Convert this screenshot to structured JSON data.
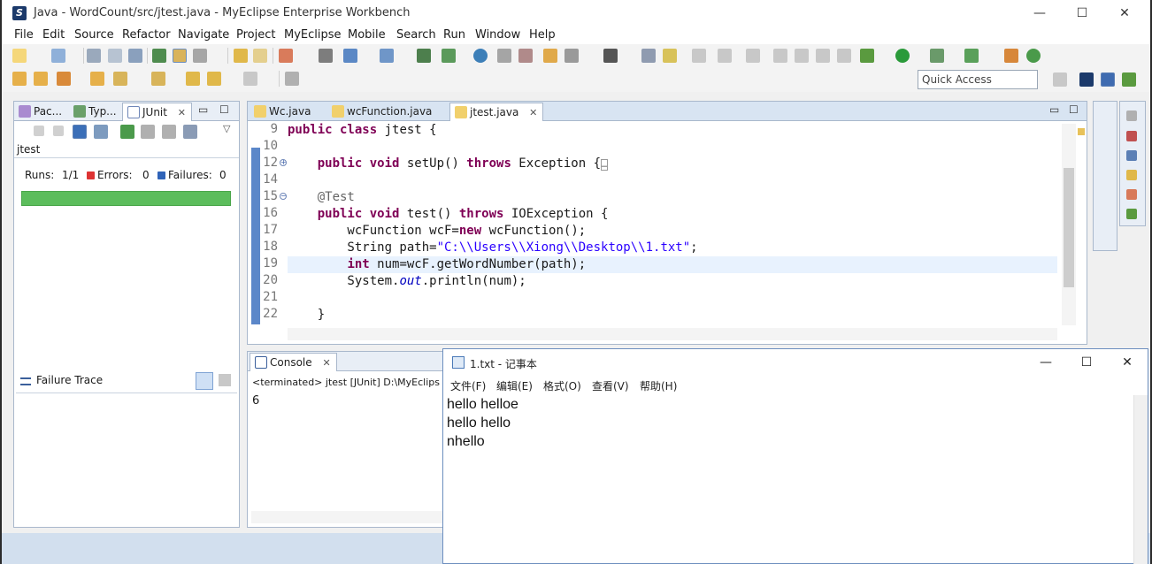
{
  "window": {
    "title": "Java - WordCount/src/jtest.java - MyEclipse Enterprise Workbench",
    "minimize": "—",
    "maximize": "☐",
    "close": "✕"
  },
  "menu": [
    "File",
    "Edit",
    "Source",
    "Refactor",
    "Navigate",
    "Project",
    "MyEclipse",
    "Mobile",
    "Search",
    "Run",
    "Window",
    "Help"
  ],
  "quick_access": {
    "label": "Quick Access"
  },
  "junit_view": {
    "tabs": [
      "Pac...",
      "Typ...",
      "JUnit"
    ],
    "test_name": "jtest",
    "runs_label": "Runs:",
    "runs_value": "1/1",
    "errors_label": "Errors:",
    "errors_value": "0",
    "failures_label": "Failures:",
    "failures_value": "0",
    "progress_fraction": 1.0,
    "failure_trace_label": "Failure Trace"
  },
  "editor": {
    "tabs": [
      "Wc.java",
      "wcFunction.java",
      "jtest.java"
    ],
    "active_tab": "jtest.java",
    "line_numbers": [
      "9",
      "10",
      "12",
      "14",
      "15",
      "16",
      "17",
      "18",
      "19",
      "20",
      "21",
      "22"
    ],
    "lines": [
      [
        "public class",
        " jtest {"
      ],
      [
        ""
      ],
      [
        "    ",
        "public void",
        " setUp() ",
        "throws",
        " Exception {",
        "…"
      ],
      [
        ""
      ],
      [
        "    ",
        "@Test"
      ],
      [
        "    ",
        "public void",
        " test() ",
        "throws",
        " IOException {"
      ],
      [
        "        wcFunction wcF=",
        "new",
        " wcFunction();"
      ],
      [
        "        String path=",
        "\"C:\\\\Users\\\\Xiong\\\\Desktop\\\\1.txt\"",
        ";"
      ],
      [
        "        ",
        "int",
        " num=wcF.getWordNumber(path);"
      ],
      [
        "        System.",
        "out",
        ".println(num);"
      ],
      [
        ""
      ],
      [
        "    }"
      ]
    ]
  },
  "console": {
    "tab": "Console",
    "status": "<terminated> jtest [JUnit] D:\\MyEclips",
    "output": "6"
  },
  "notepad": {
    "title": "1.txt - 记事本",
    "menu": [
      "文件(F)",
      "编辑(E)",
      "格式(O)",
      "查看(V)",
      "帮助(H)"
    ],
    "lines": [
      "hello helloe",
      "hello hello",
      "nhello"
    ]
  },
  "colors": {
    "progress_green": "#5cbd5c",
    "keyword": "#7f0055",
    "string": "#2a00ff",
    "annotation": "#646464"
  }
}
